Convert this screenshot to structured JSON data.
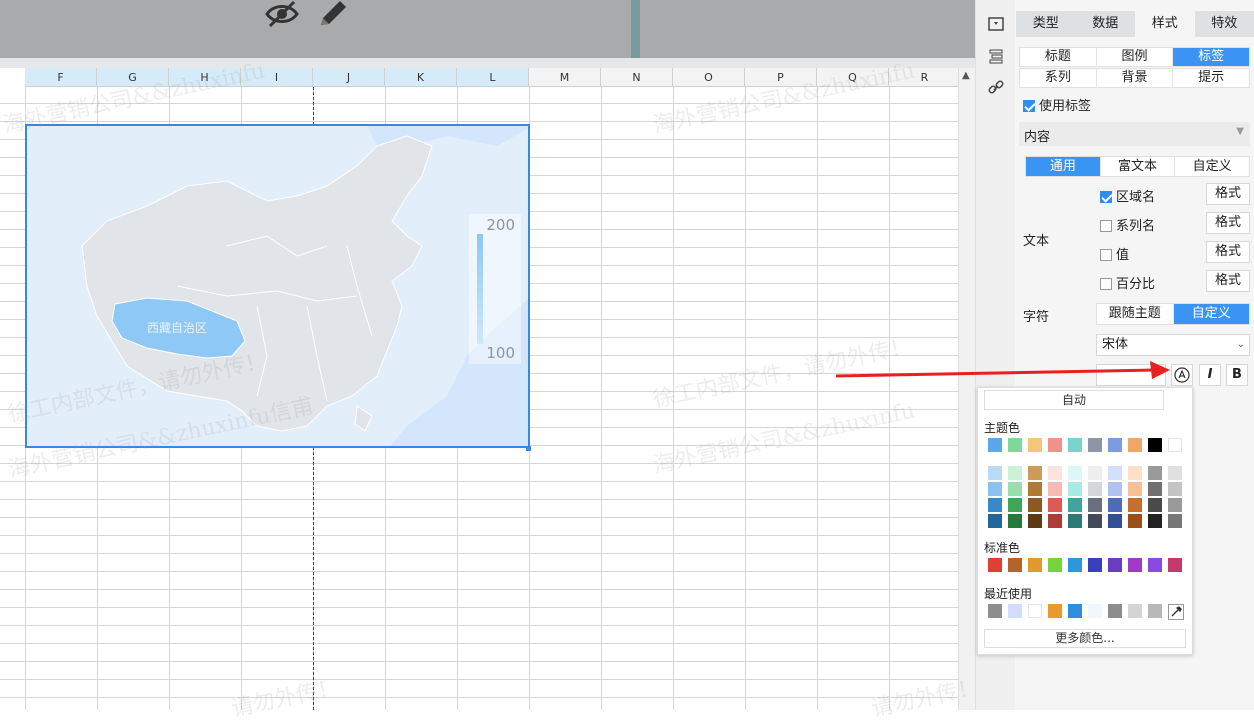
{
  "sheet": {
    "columns": [
      "F",
      "G",
      "H",
      "I",
      "J",
      "K",
      "L",
      "M",
      "N",
      "O",
      "P",
      "Q",
      "R"
    ],
    "selected_columns": [
      "F",
      "G",
      "H",
      "I",
      "J",
      "K",
      "L"
    ]
  },
  "chart": {
    "region_label": "西藏自治区",
    "legend_max": "200",
    "legend_min": "100",
    "highlight_color": "#8ec8f6",
    "land_color": "#e1e4e8",
    "sea_color": "#d4e6fb"
  },
  "watermarks": [
    "海外营销公司&&zhuxinfu",
    "徐工内部文件，请勿外传！",
    "海外营销公司&&zhuxinfu信甫",
    "徐工内部文件，请勿外传！",
    "海外营销公司&&zhuxinfu",
    "内部文件，请勿外传！",
    "请勿外传！",
    "请勿外传！"
  ],
  "panel": {
    "main_tabs": [
      "类型",
      "数据",
      "样式",
      "特效"
    ],
    "active_main_tab": "样式",
    "sub_tabs": [
      "标题",
      "图例",
      "标签",
      "系列",
      "背景",
      "提示"
    ],
    "active_sub_tab": "标签",
    "use_label": "使用标签",
    "content_dropdown": "内容",
    "content_tabs": [
      "通用",
      "富文本",
      "自定义"
    ],
    "active_content_tab": "通用",
    "text_label": "文本",
    "text_options": [
      {
        "label": "区域名",
        "checked": true
      },
      {
        "label": "系列名",
        "checked": false
      },
      {
        "label": "值",
        "checked": false
      },
      {
        "label": "百分比",
        "checked": false
      }
    ],
    "format_button": "格式",
    "char_label": "字符",
    "char_modes": [
      "跟随主题",
      "自定义"
    ],
    "active_char_mode": "自定义",
    "font_name": "宋体",
    "italic": "I",
    "bold": "B"
  },
  "color_picker": {
    "auto": "自动",
    "theme_title": "主题色",
    "theme_top": [
      "#5aa8e9",
      "#7dd89a",
      "#f4c57a",
      "#f2918c",
      "#78d4cf",
      "#8e95a5",
      "#7c9be0",
      "#f0a666",
      "#000000",
      "#ffffff"
    ],
    "theme_cols": [
      [
        "#b9dbf6",
        "#8cc3ee",
        "#3789c9",
        "#22669e"
      ],
      [
        "#c9f2d6",
        "#97e0ab",
        "#3fa659",
        "#247a38"
      ],
      [
        "#cf9b5a",
        "#b17a34",
        "#8a5a1f",
        "#5c3a12"
      ],
      [
        "#fde3e0",
        "#f7b9b3",
        "#de5a53",
        "#b03a35"
      ],
      [
        "#dcf7f5",
        "#a8ebe6",
        "#3fa59c",
        "#2a7d76"
      ],
      [
        "#eeeeee",
        "#d5d7dc",
        "#6a6f7e",
        "#444a5a"
      ],
      [
        "#d6dffa",
        "#b0c2f2",
        "#4d6dbb",
        "#324f96"
      ],
      [
        "#fde0c6",
        "#f8c092",
        "#c96f2e",
        "#9c4f19"
      ],
      [
        "#9a9a9a",
        "#707070",
        "#4a4a4a",
        "#222222"
      ],
      [
        "#e0e0e0",
        "#c4c4c4",
        "#9a9a9a",
        "#777777"
      ]
    ],
    "standard_title": "标准色",
    "standard": [
      "#e03f33",
      "#b4632b",
      "#e29a2f",
      "#76d33c",
      "#2e96db",
      "#3a3fbd",
      "#6a3cc0",
      "#a23ac8",
      "#8a4ae0",
      "#c43a6b"
    ],
    "recent_title": "最近使用",
    "recent": [
      "#8e8e8e",
      "#d3dcfb",
      "#ffffff",
      "#e89a2e",
      "#2d8fde",
      "#f2f6fe",
      "#8c8c8c",
      "#d4d4d4",
      "#b8b8b8"
    ],
    "more": "更多颜色..."
  },
  "annotation": {
    "arrow_color": "#e8201f"
  }
}
